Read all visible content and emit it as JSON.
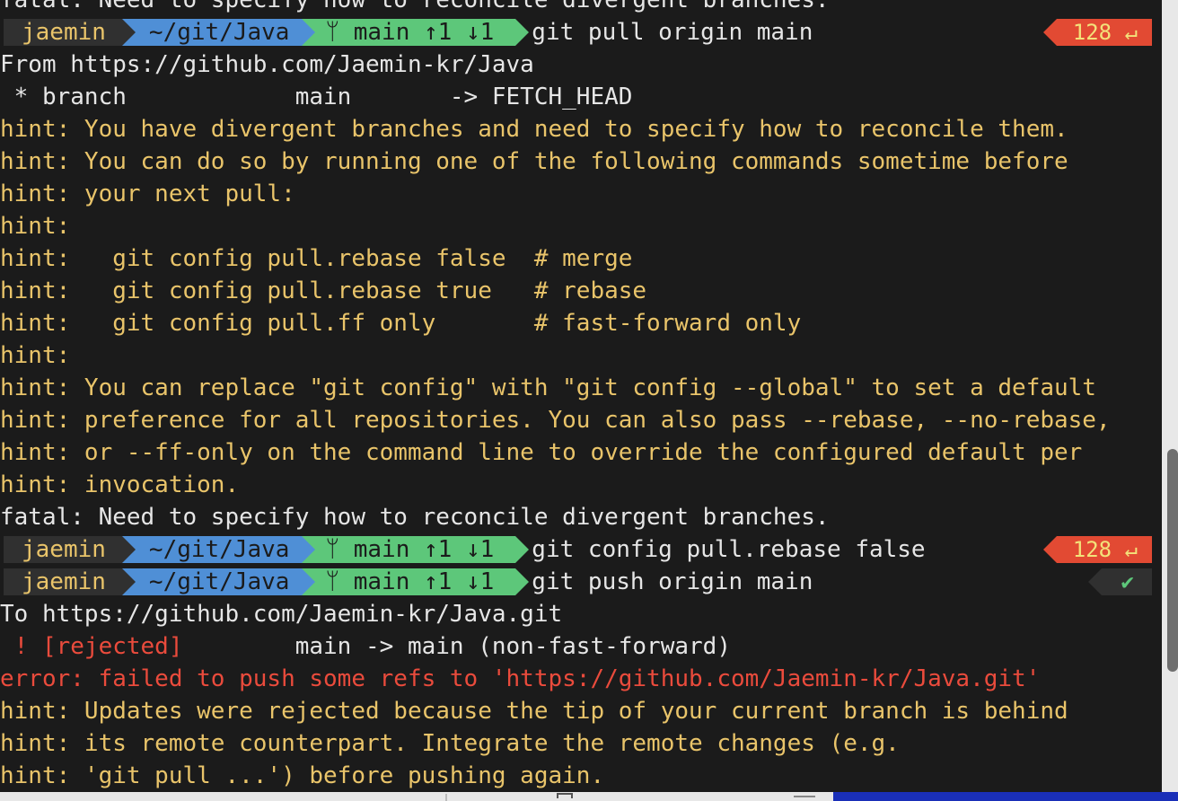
{
  "prompt": {
    "user": "jaemin",
    "dir": "~/git/Java",
    "git_icon": "branch-icon",
    "git_glyph": "",
    "branch": "main",
    "ahead": "↑1",
    "behind": "↓1"
  },
  "colors": {
    "background": "#1b1b1b",
    "text": "#e6e6e6",
    "hint": "#e9c46a",
    "error": "#ea4b3c",
    "user_segment": "#303030",
    "dir_segment": "#4f8fd6",
    "git_segment": "#5dc77a",
    "status_error": "#e24a33"
  },
  "lines": [
    {
      "kind": "text",
      "color": "white",
      "text": "fatal: Need to specify how to reconcile divergent branches."
    },
    {
      "kind": "prompt",
      "cmd": "git pull origin main",
      "status": "err",
      "code": "128 ↵"
    },
    {
      "kind": "text",
      "color": "white",
      "text": "From https://github.com/Jaemin-kr/Java"
    },
    {
      "kind": "text",
      "color": "white",
      "text": " * branch            main       -> FETCH_HEAD"
    },
    {
      "kind": "text",
      "color": "yellow",
      "text": "hint: You have divergent branches and need to specify how to reconcile them."
    },
    {
      "kind": "text",
      "color": "yellow",
      "text": "hint: You can do so by running one of the following commands sometime before"
    },
    {
      "kind": "text",
      "color": "yellow",
      "text": "hint: your next pull:"
    },
    {
      "kind": "text",
      "color": "yellow",
      "text": "hint:"
    },
    {
      "kind": "text",
      "color": "yellow",
      "text": "hint:   git config pull.rebase false  # merge"
    },
    {
      "kind": "text",
      "color": "yellow",
      "text": "hint:   git config pull.rebase true   # rebase"
    },
    {
      "kind": "text",
      "color": "yellow",
      "text": "hint:   git config pull.ff only       # fast-forward only"
    },
    {
      "kind": "text",
      "color": "yellow",
      "text": "hint:"
    },
    {
      "kind": "text",
      "color": "yellow",
      "text": "hint: You can replace \"git config\" with \"git config --global\" to set a default"
    },
    {
      "kind": "text",
      "color": "yellow",
      "text": "hint: preference for all repositories. You can also pass --rebase, --no-rebase,"
    },
    {
      "kind": "text",
      "color": "yellow",
      "text": "hint: or --ff-only on the command line to override the configured default per"
    },
    {
      "kind": "text",
      "color": "yellow",
      "text": "hint: invocation."
    },
    {
      "kind": "text",
      "color": "white",
      "text": "fatal: Need to specify how to reconcile divergent branches."
    },
    {
      "kind": "prompt",
      "cmd": "git config pull.rebase false",
      "status": "err",
      "code": "128 ↵"
    },
    {
      "kind": "prompt",
      "cmd": "git push origin main",
      "status": "ok",
      "code": "✔"
    },
    {
      "kind": "text",
      "color": "white",
      "text": "To https://github.com/Jaemin-kr/Java.git"
    },
    {
      "kind": "rejected",
      "mark": " ! [rejected]",
      "rest": "        main -> main (non-fast-forward)"
    },
    {
      "kind": "text",
      "color": "red",
      "text": "error: failed to push some refs to 'https://github.com/Jaemin-kr/Java.git'"
    },
    {
      "kind": "text",
      "color": "yellow",
      "text": "hint: Updates were rejected because the tip of your current branch is behind"
    },
    {
      "kind": "text",
      "color": "yellow",
      "text": "hint: its remote counterpart. Integrate the remote changes (e.g."
    },
    {
      "kind": "text",
      "color": "yellow",
      "text": "hint: 'git pull ...') before pushing again."
    }
  ]
}
